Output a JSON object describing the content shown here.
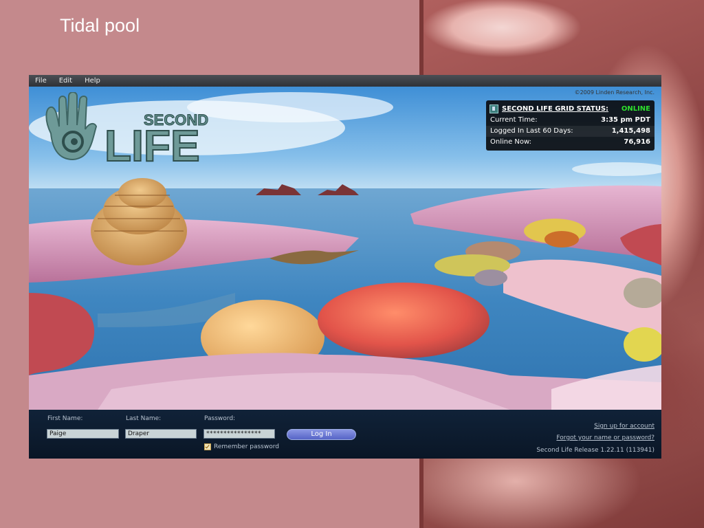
{
  "slide": {
    "title": "Tidal pool"
  },
  "menubar": {
    "items": [
      "File",
      "Edit",
      "Help"
    ]
  },
  "viewport": {
    "copyright": "©2009 Linden Research, Inc.",
    "logo": {
      "line1": "SECOND",
      "line2": "LIFE"
    }
  },
  "grid_status": {
    "title": "SECOND LIFE GRID STATUS:",
    "state": "ONLINE",
    "state_color": "#2ee02e",
    "rows": [
      {
        "label": "Current Time:",
        "value": "3:35 pm PDT"
      },
      {
        "label": "Logged In Last 60 Days:",
        "value": "1,415,498"
      },
      {
        "label": "Online Now:",
        "value": "76,916"
      }
    ]
  },
  "login": {
    "first_name_label": "First Name:",
    "first_name_value": "Paige",
    "last_name_label": "Last Name:",
    "last_name_value": "Draper",
    "password_label": "Password:",
    "password_value": "****************",
    "login_button": "Log In",
    "remember_label": "Remember password",
    "remember_checked": true,
    "signup_link": "Sign up for account",
    "forgot_link": "Forgot your name or password?",
    "version": "Second Life Release 1.22.11 (113941)"
  },
  "colors": {
    "slide_background": "#c4898c",
    "login_bar": "#0a1626",
    "button": "#6a78d6"
  }
}
